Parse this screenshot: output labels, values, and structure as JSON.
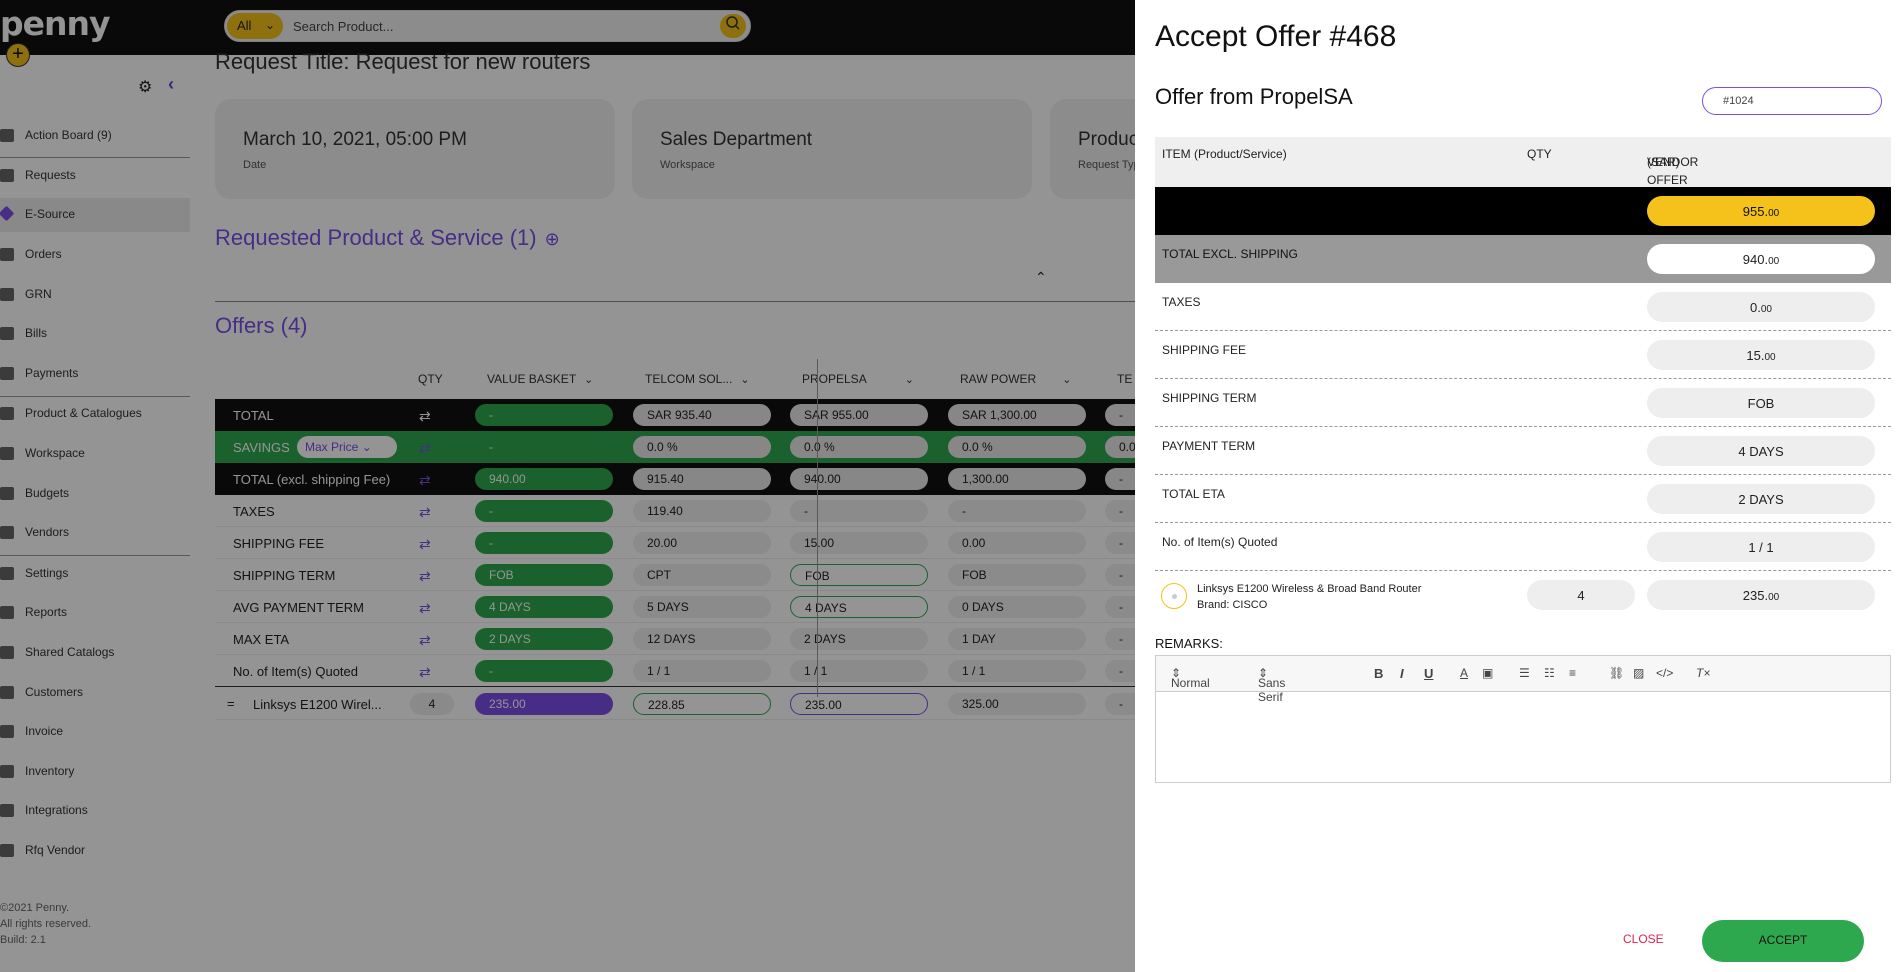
{
  "app": {
    "logo": "penny",
    "plus": "+"
  },
  "search": {
    "scope": "All",
    "placeholder": "Search Product..."
  },
  "sidebar": {
    "items": [
      {
        "label": "Action Board (9)"
      },
      {
        "label": "Requests"
      },
      {
        "label": "E-Source"
      },
      {
        "label": "Orders"
      },
      {
        "label": "GRN"
      },
      {
        "label": "Bills"
      },
      {
        "label": "Payments"
      },
      {
        "label": "Product & Catalogues"
      },
      {
        "label": "Workspace"
      },
      {
        "label": "Budgets"
      },
      {
        "label": "Vendors"
      },
      {
        "label": "Settings"
      },
      {
        "label": "Reports"
      },
      {
        "label": "Shared Catalogs"
      },
      {
        "label": "Customers"
      },
      {
        "label": "Invoice"
      },
      {
        "label": "Inventory"
      },
      {
        "label": "Integrations"
      },
      {
        "label": "Rfq Vendor"
      }
    ],
    "footer": {
      "copyright": "©2021 Penny.",
      "rights": "All rights reserved.",
      "build": "Build: 2.1"
    }
  },
  "main": {
    "request_title": "Request Title: Request for new routers",
    "cards": [
      {
        "value": "March 10, 2021, 05:00 PM",
        "label": "Date"
      },
      {
        "value": "Sales Department",
        "label": "Workspace"
      },
      {
        "value": "Product",
        "label": "Request Type"
      }
    ],
    "requested_title": "Requested Product & Service (1)",
    "offers_title": "Offers (4)",
    "table": {
      "headers": {
        "qty": "QTY",
        "value_basket": "VALUE BASKET",
        "v1": "TELCOM SOL...",
        "v2": "PROPELSA",
        "v3": "RAW POWER",
        "v4": "TE"
      },
      "max_price": "Max Price",
      "rows": [
        {
          "label": "TOTAL",
          "vb": "-",
          "v1": "SAR 935.40",
          "v2": "SAR 955.00",
          "v3": "SAR 1,300.00",
          "v4": "-"
        },
        {
          "label": "SAVINGS",
          "vb": "-",
          "v1": "0.0 %",
          "v2": "0.0 %",
          "v3": "0.0 %",
          "v4": "0.0"
        },
        {
          "label": "TOTAL (excl. shipping Fee)",
          "vb": "940.00",
          "v1": "915.40",
          "v2": "940.00",
          "v3": "1,300.00",
          "v4": "-"
        },
        {
          "label": "TAXES",
          "vb": "-",
          "v1": "119.40",
          "v2": "-",
          "v3": "-",
          "v4": "-"
        },
        {
          "label": "SHIPPING FEE",
          "vb": "-",
          "v1": "20.00",
          "v2": "15.00",
          "v3": "0.00",
          "v4": "-"
        },
        {
          "label": "SHIPPING TERM",
          "vb": "FOB",
          "v1": "CPT",
          "v2": "FOB",
          "v3": "FOB",
          "v4": "-"
        },
        {
          "label": "AVG PAYMENT TERM",
          "vb": "4 DAYS",
          "v1": "5 DAYS",
          "v2": "4 DAYS",
          "v3": "0 DAYS",
          "v4": "-"
        },
        {
          "label": "MAX ETA",
          "vb": "2 DAYS",
          "v1": "12 DAYS",
          "v2": "2 DAYS",
          "v3": "1 DAY",
          "v4": "-"
        },
        {
          "label": "No. of Item(s) Quoted",
          "vb": "-",
          "v1": "1 / 1",
          "v2": "1 / 1",
          "v3": "1 / 1",
          "v4": "-"
        },
        {
          "label": "Linksys E1200 Wirel...",
          "qty": "4",
          "vb": "235.00",
          "v1": "228.85",
          "v2": "235.00",
          "v3": "325.00",
          "v4": "-"
        }
      ]
    }
  },
  "drawer": {
    "title": "Accept Offer #468",
    "subtitle": "Offer from PropelSA",
    "ref_value": "#1024",
    "headers": {
      "item": "ITEM (Product/Service)",
      "qty": "QTY",
      "offer1": "VENDOR OFFER",
      "offer2": "(SAR)"
    },
    "total": {
      "int": "955.",
      "dec": "00"
    },
    "rows": [
      {
        "label": "TOTAL EXCL. SHIPPING",
        "int": "940.",
        "dec": "00"
      },
      {
        "label": "TAXES",
        "int": "0.",
        "dec": "00"
      },
      {
        "label": "SHIPPING FEE",
        "int": "15.",
        "dec": "00"
      },
      {
        "label": "SHIPPING TERM",
        "int": "FOB",
        "dec": ""
      },
      {
        "label": "PAYMENT TERM",
        "int": "4 DAYS",
        "dec": ""
      },
      {
        "label": "TOTAL ETA",
        "int": "2 DAYS",
        "dec": ""
      },
      {
        "label": "No. of Item(s) Quoted",
        "int": "1 / 1",
        "dec": ""
      }
    ],
    "item": {
      "name": "Linksys E1200 Wireless & Broad Band Router",
      "brand": "Brand: CISCO",
      "qty": "4",
      "int": "235.",
      "dec": "00"
    },
    "remarks_label": "REMARKS:",
    "editor": {
      "style": "Normal",
      "font": "Sans Serif"
    },
    "close_label": "CLOSE",
    "accept_label": "ACCEPT"
  },
  "colors": {
    "accent": "#7b4fe6",
    "brand_yellow": "#f5c21b",
    "green": "#2ea84e",
    "danger": "#e0234a"
  }
}
